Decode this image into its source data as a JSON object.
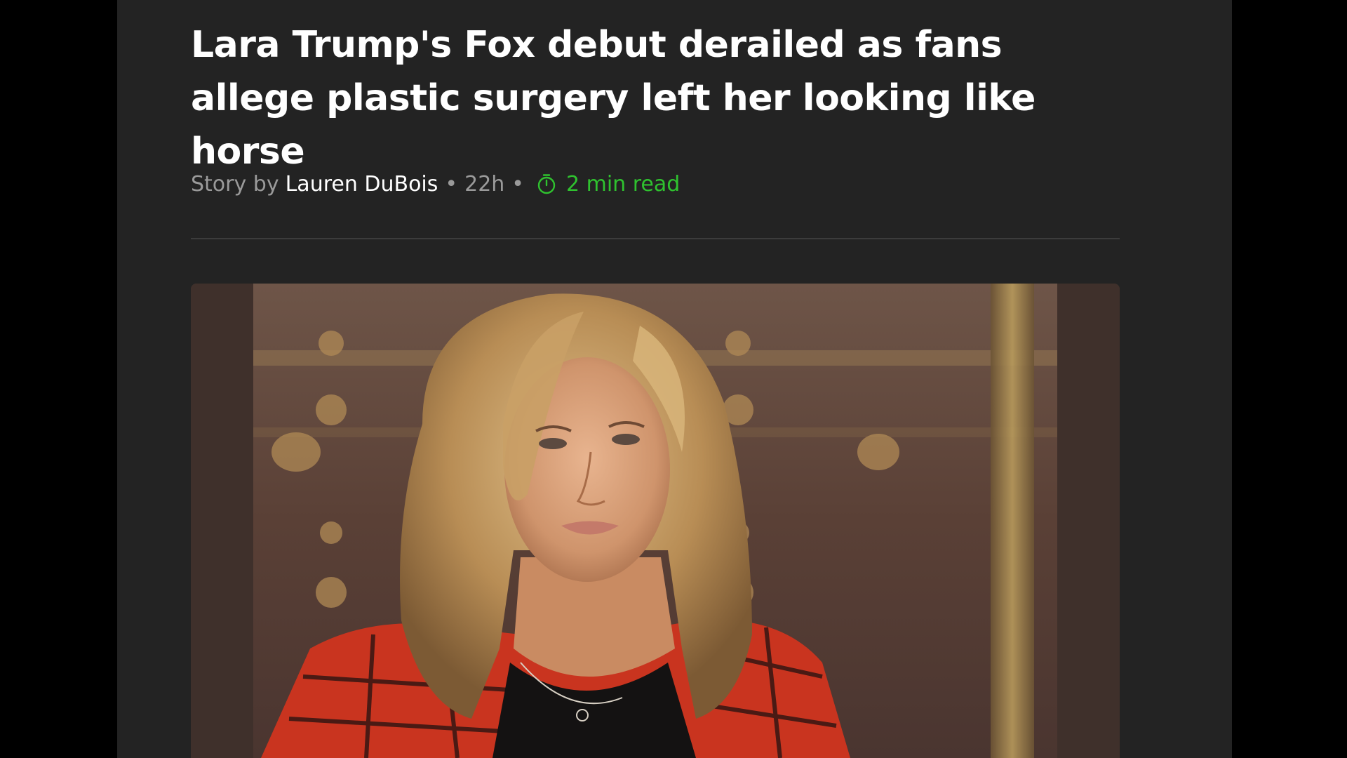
{
  "article": {
    "headline": "Lara Trump's Fox debut derailed as fans allege plastic surgery left her looking like horse",
    "byline": {
      "prefix": "Story by",
      "author": "Lauren DuBois",
      "age": "22h",
      "separator": "•",
      "read_time": "2 min read"
    },
    "hero_image": {
      "alt": "Lara Trump portrait"
    }
  },
  "colors": {
    "page_background": "#232323",
    "outer_background": "#000000",
    "headline": "#ffffff",
    "byline_muted": "#9a9a9a",
    "author": "#ffffff",
    "read_time_accent": "#2fc22f"
  },
  "icons": {
    "read_time": "timer-icon"
  }
}
